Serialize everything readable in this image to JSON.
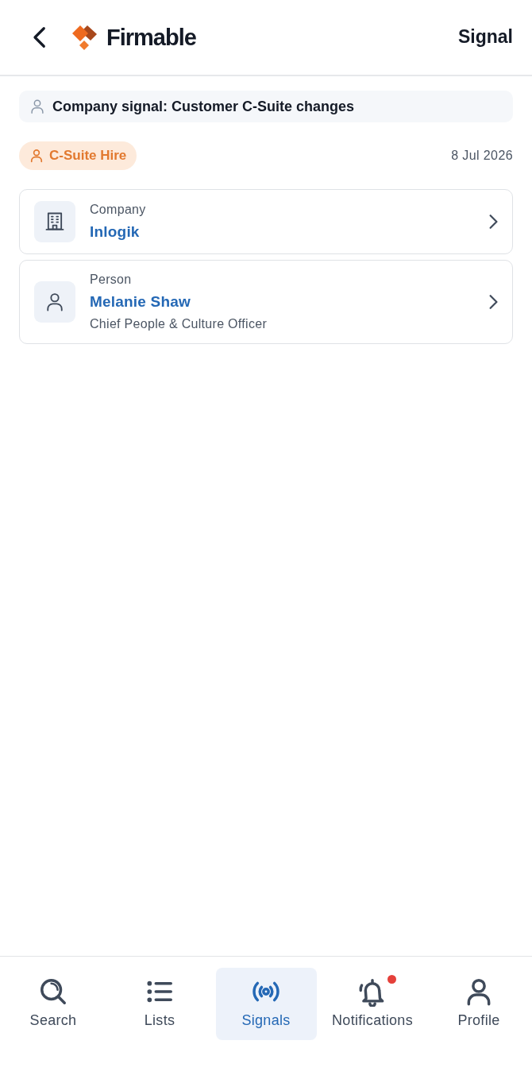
{
  "header": {
    "logo_text": "Firmable",
    "title": "Signal"
  },
  "signal": {
    "text": "Company signal: Customer C-Suite changes"
  },
  "tag": {
    "label": "C-Suite Hire"
  },
  "date": "8 Jul 2026",
  "entities": [
    {
      "kind": "company",
      "label": "Company",
      "name": "Inlogik"
    },
    {
      "kind": "person",
      "label": "Person",
      "name": "Melanie Shaw",
      "subtitle": "Chief People & Culture Officer"
    }
  ],
  "nav": [
    {
      "kind": "search",
      "label": "Search",
      "selected": false,
      "badge": false
    },
    {
      "kind": "lists",
      "label": "Lists",
      "selected": false,
      "badge": false
    },
    {
      "kind": "signals",
      "label": "Signals",
      "selected": true,
      "badge": false
    },
    {
      "kind": "notifications",
      "label": "Notifications",
      "selected": false,
      "badge": true
    },
    {
      "kind": "profile",
      "label": "Profile",
      "selected": false,
      "badge": false
    }
  ]
}
